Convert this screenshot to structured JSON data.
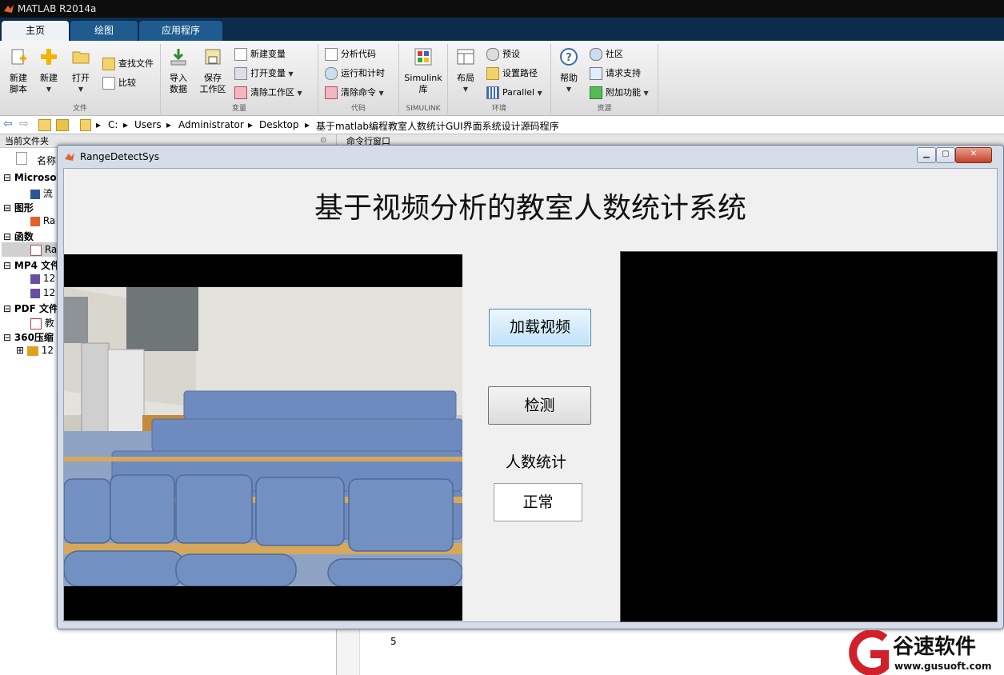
{
  "app": {
    "title": "MATLAB R2014a"
  },
  "tabs": [
    {
      "label": "主页"
    },
    {
      "label": "绘图"
    },
    {
      "label": "应用程序"
    }
  ],
  "ribbon": {
    "groups": [
      "文件",
      "变量",
      "代码",
      "SIMULINK",
      "环境",
      "资源"
    ],
    "file": {
      "new_script": "新建\n脚本",
      "new": "新建",
      "open": "打开",
      "find_files": "查找文件",
      "compare": "比较"
    },
    "variable": {
      "import": "导入\n数据",
      "save_ws": "保存\n工作区",
      "new_var": "新建变量",
      "open_var": "打开变量",
      "clear_ws": "清除工作区"
    },
    "code": {
      "analyze": "分析代码",
      "run_time": "运行和计时",
      "clear_cmd": "清除命令"
    },
    "simulink": {
      "lib": "Simulink\n库"
    },
    "env": {
      "layout": "布局",
      "prefs": "预设",
      "set_path": "设置路径",
      "parallel": "Parallel"
    },
    "resources": {
      "help": "帮助",
      "community": "社区",
      "support": "请求支持",
      "addons": "附加功能"
    }
  },
  "address": {
    "crumbs": [
      "C:",
      "Users",
      "Administrator",
      "Desktop",
      "基于matlab编程教室人数统计GUI界面系统设计源码程序"
    ]
  },
  "left_panel": {
    "header": "当前文件夹",
    "column": "名称",
    "items": [
      {
        "label": "Microsoft",
        "bold": true
      },
      {
        "label": "流",
        "bold": false
      },
      {
        "label": "图形",
        "bold": true
      },
      {
        "label": "Ra",
        "bold": false
      },
      {
        "label": "函数",
        "bold": true
      },
      {
        "label": "Ra",
        "bold": false
      },
      {
        "label": "MP4 文件",
        "bold": true
      },
      {
        "label": "12",
        "bold": false
      },
      {
        "label": "12",
        "bold": false
      },
      {
        "label": "PDF 文件",
        "bold": true
      },
      {
        "label": "教",
        "bold": false
      },
      {
        "label": "360压缩",
        "bold": true
      },
      {
        "label": "12",
        "bold": false
      }
    ]
  },
  "command_window": {
    "header": "命令行窗口",
    "line": "5"
  },
  "figure": {
    "window_title": "RangeDetectSys",
    "heading": "基于视频分析的教室人数统计系统",
    "load_button": "加载视频",
    "detect_button": "检测",
    "count_label": "人数统计",
    "count_value": "正常"
  },
  "watermark": {
    "name": "谷速软件",
    "url": "www.gusuoft.com"
  },
  "colors": {
    "tab_bar": "#0c2c4c",
    "accent": "#1f5b8f",
    "watermark_red": "#d2202a"
  }
}
